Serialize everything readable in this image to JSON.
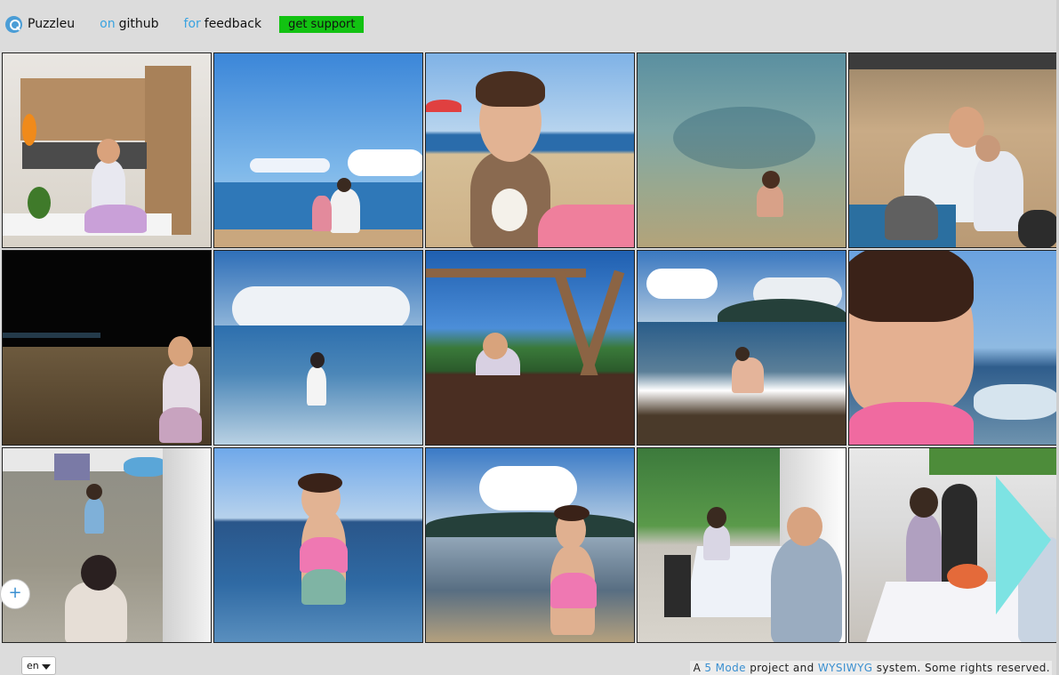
{
  "header": {
    "brand": "Puzzleu",
    "github_kw": "on",
    "github_label": "github",
    "feedback_kw": "for",
    "feedback_label": "feedback",
    "support_label": "get support"
  },
  "grid": {
    "tiles": [
      {
        "scene": "kitchen"
      },
      {
        "scene": "beach-sky"
      },
      {
        "scene": "girl-sand"
      },
      {
        "scene": "shallow-water"
      },
      {
        "scene": "man-girl-sand"
      },
      {
        "scene": "night-wall"
      },
      {
        "scene": "sea-clouds"
      },
      {
        "scene": "swing"
      },
      {
        "scene": "sea-island"
      },
      {
        "scene": "girl-profile"
      },
      {
        "scene": "patio"
      },
      {
        "scene": "girl-swimsuit"
      },
      {
        "scene": "girl-shore"
      },
      {
        "scene": "table-garden"
      },
      {
        "scene": "table-porch"
      }
    ]
  },
  "controls": {
    "add_label": "+",
    "next_icon": "chevron-right-icon"
  },
  "footer": {
    "lang": "en",
    "prefix": "A",
    "link1": "5 Mode",
    "mid": "project and",
    "link2": "WYSIWYG",
    "suffix": "system. Some rights reserved."
  },
  "colors": {
    "accent": "#3aa3e0",
    "support": "#12c212",
    "arrow": "#7de3e3"
  }
}
